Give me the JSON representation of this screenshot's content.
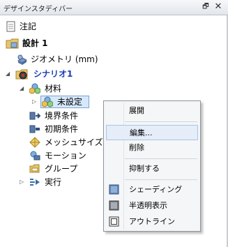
{
  "panel": {
    "title": "デザインスタディバー",
    "pin_glyph": "🗗",
    "close_glyph": "✕"
  },
  "tree": {
    "notes": "注記",
    "design": "設計 1",
    "geometry": "ジオメトリ (mm)",
    "scenario": "シナリオ1",
    "materials": "材料",
    "unset": "未設定",
    "boundary": "境界条件",
    "initial": "初期条件",
    "mesh": "メッシュサイズ",
    "motion": "モーション",
    "group": "グループ",
    "run": "実行"
  },
  "context_menu": {
    "expand": "展開",
    "edit": "編集...",
    "delete": "削除",
    "suppress": "抑制する",
    "shading": "シェーディング",
    "translucent": "半透明表示",
    "outline": "アウトライン"
  },
  "colors": {
    "accent_blue": "#1a3fb3",
    "selection": "#d6e8fb",
    "menu_highlight": "#e4edf8"
  }
}
